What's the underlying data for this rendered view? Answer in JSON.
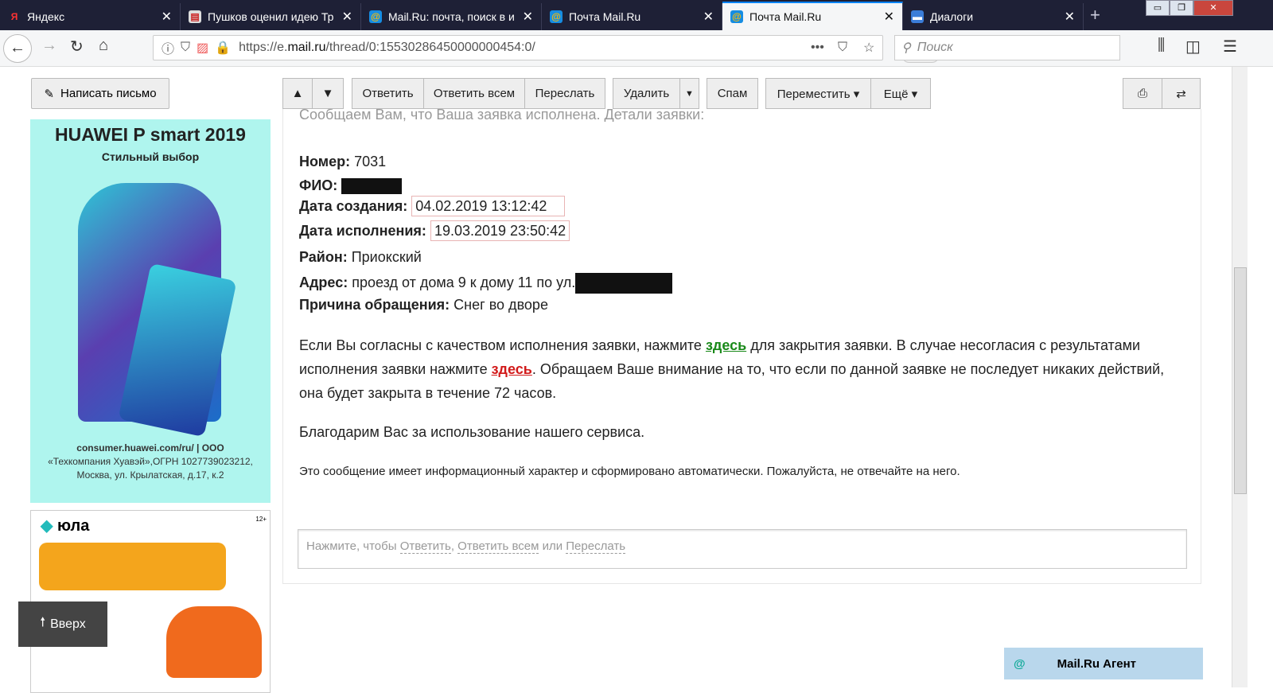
{
  "browser": {
    "tabs": [
      {
        "label": "Яндекс",
        "icon": "yandex-icon",
        "active": false
      },
      {
        "label": "Пушков оценил идею Тр",
        "icon": "news-icon",
        "active": false
      },
      {
        "label": "Mail.Ru: почта, поиск в и",
        "icon": "mailru-icon",
        "active": false
      },
      {
        "label": "Почта Mail.Ru",
        "icon": "mailru-icon",
        "active": false
      },
      {
        "label": "Почта Mail.Ru",
        "icon": "mailru-icon",
        "active": true
      },
      {
        "label": "Диалоги",
        "icon": "dialogs-icon",
        "active": false
      }
    ],
    "url_prefix": "https://e.",
    "url_host": "mail.ru",
    "url_path": "/thread/0:15530286450000000454:0/",
    "zoom": "110%",
    "search_placeholder": "Поиск"
  },
  "sidebar": {
    "compose": "Написать письмо",
    "ad1": {
      "title": "HUAWEI P smart 2019",
      "subtitle": "Стильный выбор",
      "legal1": "consumer.huawei.com/ru/ | ООО",
      "legal2": "«Техкомпания Хуавэй»,ОГРН 1027739023212,",
      "legal3": "Москва, ул. Крылатская, д.17, к.2"
    },
    "ad2": {
      "brand": "юла",
      "age": "12+"
    },
    "up": "Вверх"
  },
  "toolbar": {
    "reply": "Ответить",
    "reply_all": "Ответить всем",
    "forward": "Переслать",
    "delete": "Удалить",
    "spam": "Спам",
    "move": "Переместить ▾",
    "more": "Ещё ▾"
  },
  "message": {
    "intro": "Сообщаем Вам, что Ваша заявка исполнена. Детали заявки:",
    "fields": [
      {
        "label": "Номер:",
        "value": "7031"
      },
      {
        "label": "ФИО:",
        "value": ""
      },
      {
        "label": "Дата создания:",
        "value": "04.02.2019 13:12:42"
      },
      {
        "label": "Дата исполнения:",
        "value": "19.03.2019 23:50:42"
      },
      {
        "label": "Район:",
        "value": "Приокский"
      },
      {
        "label": "Адрес:",
        "value": "проезд от дома 9 к дому 11 по ул."
      },
      {
        "label": "Причина обращения:",
        "value": "Снег во дворе"
      }
    ],
    "p1a": "Если Вы согласны с качеством исполнения заявки, нажмите ",
    "link_here": "здесь",
    "p1b": " для закрытия заявки. В случае несогласия с результатами исполнения заявки нажмите ",
    "p1c": ". Обращаем Ваше внимание на то, что если по данной заявке не последует никаких действий, она будет закрыта в течение 72 часов.",
    "thanks": "Благодарим Вас за использование нашего сервиса.",
    "auto": "Это сообщение имеет информационный характер и сформировано автоматически. Пожалуйста, не отвечайте на него.",
    "reply_a": "Нажмите, чтобы ",
    "reply_r": "Ответить",
    "reply_comma": ", ",
    "reply_ra": "Ответить всем",
    "reply_or": " или ",
    "reply_f": "Переслать"
  },
  "agent": "Mail.Ru Агент"
}
